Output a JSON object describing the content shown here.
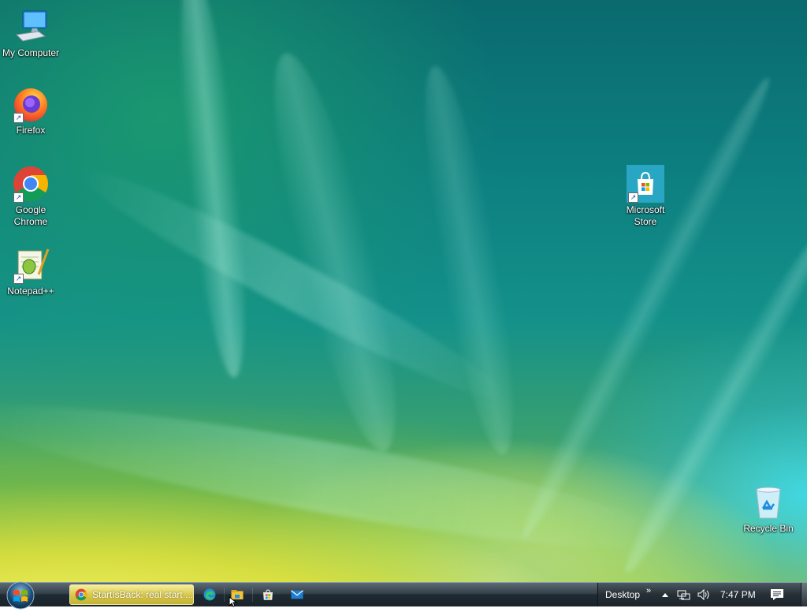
{
  "desktop": {
    "icons": [
      {
        "label": "My Computer",
        "icon": "computer-icon"
      },
      {
        "label": "Firefox",
        "icon": "firefox-icon"
      },
      {
        "label": "Google Chrome",
        "icon": "chrome-icon"
      },
      {
        "label": "Notepad++",
        "icon": "notepadpp-icon"
      },
      {
        "label": "Microsoft Store",
        "icon": "store-icon"
      },
      {
        "label": "Recycle Bin",
        "icon": "recycle-bin-icon"
      }
    ]
  },
  "taskbar": {
    "start_button": "start-orb-icon",
    "active_task": {
      "label": "StartIsBack: real start ...",
      "icon": "chrome-icon"
    },
    "pinned": [
      "edge-icon",
      "file-explorer-icon",
      "store-icon",
      "mail-icon"
    ],
    "tray": {
      "toolbar_label": "Desktop",
      "chevron": "»",
      "time": "7:47 PM"
    }
  },
  "colors": {
    "taskbar": "#1f2a32",
    "active_task": "#d9c94d",
    "desktop_label": "#ffffff"
  }
}
